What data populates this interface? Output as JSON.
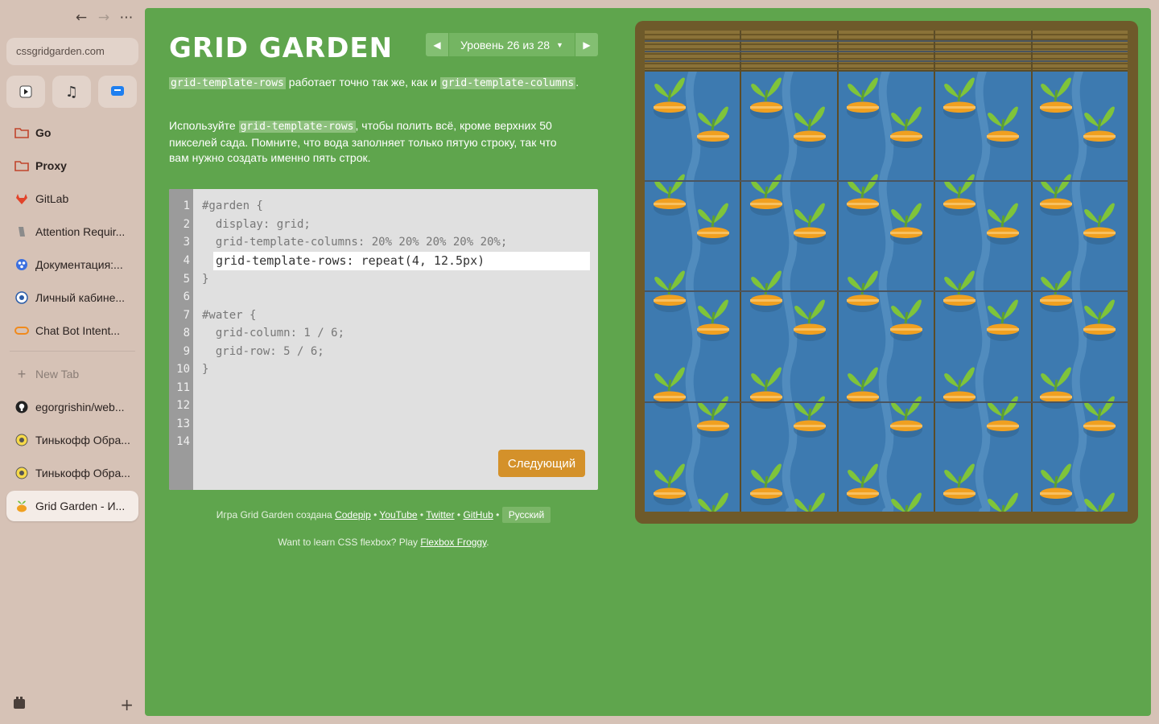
{
  "browser": {
    "url": "cssgridgarden.com",
    "tabs": [
      {
        "label": "Go",
        "icon": "folder-icon",
        "bold": true
      },
      {
        "label": "Proxy",
        "icon": "folder-icon",
        "bold": true
      },
      {
        "label": "GitLab",
        "icon": "gitlab-icon"
      },
      {
        "label": "Attention Requir...",
        "icon": "site-icon"
      },
      {
        "label": "Документация:...",
        "icon": "docs-icon"
      },
      {
        "label": "Личный кабине...",
        "icon": "cabinet-icon"
      },
      {
        "label": "Chat Bot Intent...",
        "icon": "chatbot-icon"
      }
    ],
    "new_tab_label": "New Tab",
    "tabs_below": [
      {
        "label": "egorgrishin/web...",
        "icon": "github-icon"
      },
      {
        "label": "Тинькофф Обра...",
        "icon": "tinkoff-icon"
      },
      {
        "label": "Тинькофф Обра...",
        "icon": "tinkoff-icon"
      },
      {
        "label": "Grid Garden - И...",
        "icon": "carrot-icon",
        "active": true
      }
    ]
  },
  "game": {
    "title": "GRID GARDEN",
    "level_label": "Уровень 26 из 28",
    "instructions_1": {
      "code_a": "grid-template-rows",
      "text_a": " работает точно так же, как и ",
      "code_b": "grid-template-columns",
      "text_b": "."
    },
    "instructions_2": {
      "text_a": "Используйте ",
      "code_a": "grid-template-rows",
      "text_b": ", чтобы полить всё, кроме верхних 50 пикселей сада. Помните, что вода заполняет только пятую строку, так что вам нужно создать именно пять строк."
    },
    "line_numbers": [
      "1",
      "2",
      "3",
      "4",
      "5",
      "6",
      "7",
      "8",
      "9",
      "10",
      "11",
      "12",
      "13",
      "14"
    ],
    "code_lines": {
      "l1": "#garden {",
      "l2": "  display: grid;",
      "l3": "  grid-template-columns: 20% 20% 20% 20% 20%;",
      "l5": "}",
      "l7": "#water {",
      "l8": "  grid-column: 1 / 6;",
      "l9": "  grid-row: 5 / 6;",
      "l10": "}"
    },
    "input_value": "grid-template-rows: repeat(4, 12.5px)",
    "next_button": "Следующий",
    "credits": {
      "prefix": "Игра Grid Garden создана ",
      "codepip": "Codepip",
      "youtube": "YouTube",
      "twitter": "Twitter",
      "github": "GitHub",
      "language": "Русский",
      "bullet": " • "
    },
    "froggy": {
      "text": "Want to learn CSS flexbox? Play ",
      "link": "Flexbox Froggy",
      "end": "."
    },
    "colors": {
      "background": "#5fa54d",
      "soil": "#3d7ab0",
      "carrot": "#f0a020",
      "leaf": "#7fc43a",
      "button": "#d4912a"
    }
  }
}
